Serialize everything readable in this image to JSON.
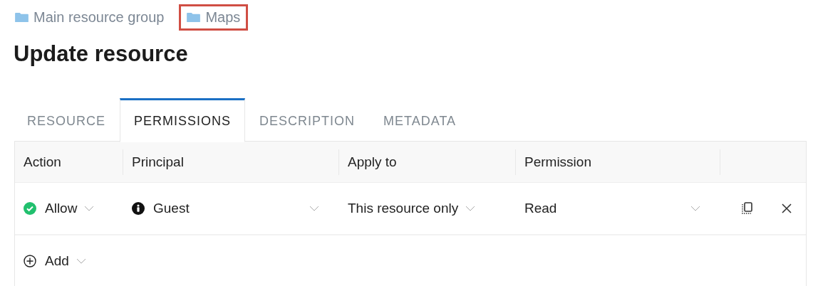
{
  "breadcrumb": [
    {
      "label": "Main resource group",
      "highlighted": false
    },
    {
      "label": "Maps",
      "highlighted": true
    }
  ],
  "title": "Update resource",
  "tabs": [
    {
      "label": "RESOURCE",
      "selected": false
    },
    {
      "label": "PERMISSIONS",
      "selected": true
    },
    {
      "label": "DESCRIPTION",
      "selected": false
    },
    {
      "label": "METADATA",
      "selected": false
    }
  ],
  "table": {
    "columns": [
      "Action",
      "Principal",
      "Apply to",
      "Permission"
    ],
    "rows": [
      {
        "action": "Allow",
        "principal": "Guest",
        "apply_to": "This resource only",
        "permission": "Read"
      }
    ]
  },
  "add_label": "Add"
}
